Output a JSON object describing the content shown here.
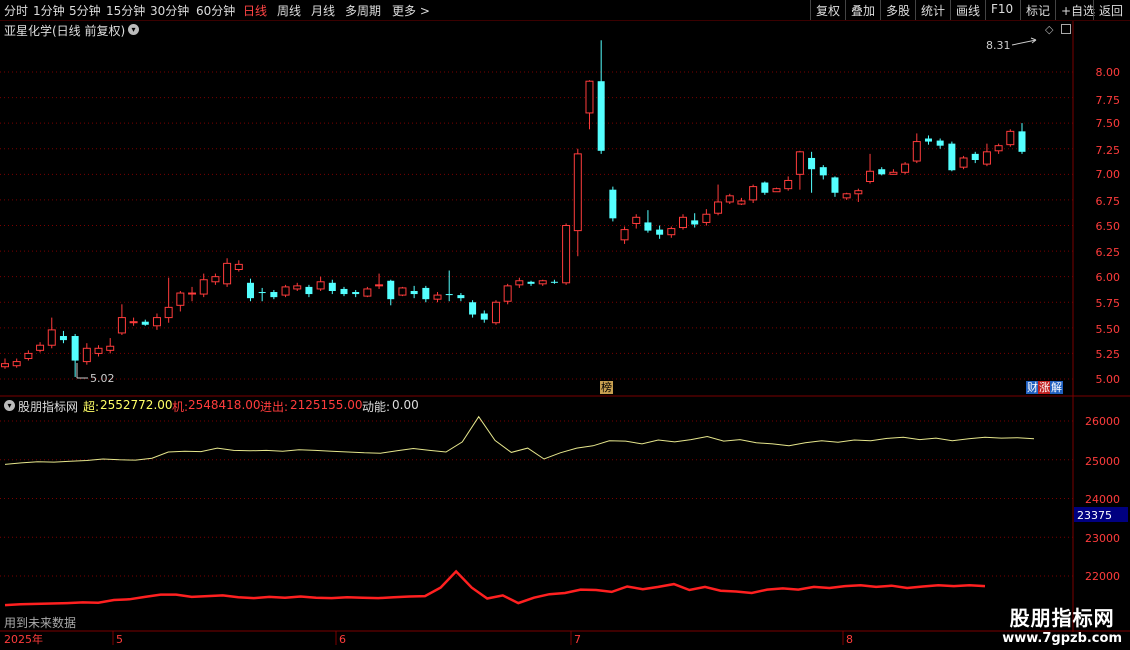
{
  "toolbar": {
    "periods": [
      "分时",
      "1分钟",
      "5分钟",
      "15分钟",
      "30分钟",
      "60分钟",
      "日线",
      "周线",
      "月线",
      "多周期",
      "更多"
    ],
    "active": "日线",
    "right": [
      "复权",
      "叠加",
      "多股",
      "统计",
      "画线",
      "F10",
      "标记",
      "+自选",
      "返回"
    ]
  },
  "stock": {
    "title": "亚星化学(日线 前复权)",
    "high_label": "8.31",
    "low_label": "5.02"
  },
  "price_axis": [
    "8.00",
    "7.75",
    "7.50",
    "7.25",
    "7.00",
    "6.75",
    "6.50",
    "6.25",
    "6.00",
    "5.75",
    "5.50",
    "5.25",
    "5.00"
  ],
  "tags": {
    "bang": "榜",
    "cai": "财",
    "zhang": "涨",
    "jie": "解"
  },
  "indicator": {
    "name": "股朋指标网",
    "chao_label": "超:",
    "chao_value": "2552772.00",
    "ji_label": "机:",
    "ji_value": "2548418.00",
    "jinchu_label": "进出:",
    "jinchu_value": "2125155.00",
    "dongneng_label": "动能:",
    "dongneng_value": "0.00",
    "axis": [
      "26000",
      "25000",
      "24000",
      "23000",
      "22000"
    ],
    "cursor_value": "23375",
    "note": "用到未来数据"
  },
  "dates": [
    "2025年",
    "5",
    "6",
    "7",
    "8"
  ],
  "logo": {
    "main": "股朋指标网",
    "sub": "www.7gpzb.com"
  },
  "colors": {
    "up": "#ff3c3c",
    "down": "#54ffff",
    "grid": "#7a0000",
    "yellow_line": "#e6e68c",
    "red_line": "#ff2020"
  },
  "chart_data": {
    "type": "candlestick",
    "ylim": [
      5.0,
      8.31
    ],
    "candles": [
      [
        5.12,
        5.15,
        5.2,
        5.1
      ],
      [
        5.13,
        5.17,
        5.2,
        5.11
      ],
      [
        5.2,
        5.25,
        5.28,
        5.18
      ],
      [
        5.28,
        5.33,
        5.36,
        5.26
      ],
      [
        5.33,
        5.48,
        5.6,
        5.3
      ],
      [
        5.42,
        5.38,
        5.47,
        5.35
      ],
      [
        5.42,
        5.18,
        5.44,
        5.02
      ],
      [
        5.17,
        5.3,
        5.35,
        5.14
      ],
      [
        5.25,
        5.3,
        5.33,
        5.22
      ],
      [
        5.28,
        5.32,
        5.4,
        5.25
      ],
      [
        5.45,
        5.6,
        5.73,
        5.43
      ],
      [
        5.55,
        5.56,
        5.6,
        5.52
      ],
      [
        5.56,
        5.53,
        5.58,
        5.52
      ],
      [
        5.52,
        5.6,
        5.64,
        5.48
      ],
      [
        5.6,
        5.7,
        5.99,
        5.55
      ],
      [
        5.72,
        5.84,
        5.86,
        5.66
      ],
      [
        5.84,
        5.84,
        5.9,
        5.76
      ],
      [
        5.83,
        5.97,
        6.03,
        5.8
      ],
      [
        5.95,
        6.0,
        6.03,
        5.92
      ],
      [
        5.93,
        6.13,
        6.18,
        5.9
      ],
      [
        6.07,
        6.12,
        6.16,
        6.05
      ],
      [
        5.94,
        5.79,
        5.98,
        5.76
      ],
      [
        5.85,
        5.84,
        5.89,
        5.76
      ],
      [
        5.85,
        5.8,
        5.87,
        5.78
      ],
      [
        5.82,
        5.9,
        5.92,
        5.8
      ],
      [
        5.88,
        5.91,
        5.94,
        5.86
      ],
      [
        5.9,
        5.83,
        5.92,
        5.8
      ],
      [
        5.88,
        5.95,
        6.0,
        5.86
      ],
      [
        5.94,
        5.86,
        5.97,
        5.83
      ],
      [
        5.88,
        5.83,
        5.9,
        5.81
      ],
      [
        5.85,
        5.83,
        5.87,
        5.8
      ],
      [
        5.81,
        5.88,
        5.9,
        5.8
      ],
      [
        5.92,
        5.92,
        6.03,
        5.88
      ],
      [
        5.96,
        5.78,
        5.97,
        5.72
      ],
      [
        5.82,
        5.89,
        5.9,
        5.81
      ],
      [
        5.86,
        5.83,
        5.91,
        5.79
      ],
      [
        5.89,
        5.78,
        5.91,
        5.75
      ],
      [
        5.78,
        5.82,
        5.85,
        5.75
      ],
      [
        5.83,
        5.82,
        6.06,
        5.76
      ],
      [
        5.82,
        5.79,
        5.84,
        5.76
      ],
      [
        5.75,
        5.63,
        5.77,
        5.6
      ],
      [
        5.64,
        5.58,
        5.67,
        5.55
      ],
      [
        5.55,
        5.75,
        5.77,
        5.53
      ],
      [
        5.76,
        5.91,
        5.93,
        5.73
      ],
      [
        5.92,
        5.96,
        5.99,
        5.89
      ],
      [
        5.95,
        5.93,
        5.96,
        5.91
      ],
      [
        5.93,
        5.96,
        5.97,
        5.91
      ],
      [
        5.95,
        5.94,
        5.97,
        5.93
      ],
      [
        5.94,
        6.5,
        6.52,
        5.92
      ],
      [
        6.45,
        7.2,
        7.25,
        6.2
      ],
      [
        7.6,
        7.91,
        7.92,
        7.44
      ],
      [
        7.91,
        7.23,
        8.31,
        7.2
      ],
      [
        6.85,
        6.57,
        6.88,
        6.54
      ],
      [
        6.36,
        6.46,
        6.49,
        6.32
      ],
      [
        6.52,
        6.58,
        6.61,
        6.47
      ],
      [
        6.53,
        6.45,
        6.65,
        6.43
      ],
      [
        6.46,
        6.41,
        6.5,
        6.37
      ],
      [
        6.41,
        6.47,
        6.49,
        6.38
      ],
      [
        6.48,
        6.58,
        6.61,
        6.46
      ],
      [
        6.55,
        6.51,
        6.62,
        6.48
      ],
      [
        6.53,
        6.61,
        6.66,
        6.5
      ],
      [
        6.62,
        6.73,
        6.9,
        6.6
      ],
      [
        6.73,
        6.79,
        6.81,
        6.71
      ],
      [
        6.71,
        6.74,
        6.77,
        6.7
      ],
      [
        6.75,
        6.88,
        6.9,
        6.72
      ],
      [
        6.92,
        6.82,
        6.93,
        6.8
      ],
      [
        6.83,
        6.86,
        6.87,
        6.83
      ],
      [
        6.86,
        6.94,
        6.98,
        6.84
      ],
      [
        7.0,
        7.22,
        7.23,
        6.85
      ],
      [
        7.16,
        7.05,
        7.22,
        6.82
      ],
      [
        7.07,
        6.99,
        7.09,
        6.95
      ],
      [
        6.97,
        6.82,
        6.98,
        6.78
      ],
      [
        6.77,
        6.81,
        6.82,
        6.75
      ],
      [
        6.81,
        6.84,
        6.86,
        6.73
      ],
      [
        6.93,
        7.03,
        7.2,
        6.91
      ],
      [
        7.05,
        7.0,
        7.07,
        6.99
      ],
      [
        7.0,
        7.02,
        7.05,
        7.0
      ],
      [
        7.02,
        7.1,
        7.12,
        7.0
      ],
      [
        7.13,
        7.32,
        7.4,
        7.11
      ],
      [
        7.35,
        7.32,
        7.38,
        7.29
      ],
      [
        7.33,
        7.28,
        7.35,
        7.25
      ],
      [
        7.3,
        7.04,
        7.32,
        7.03
      ],
      [
        7.07,
        7.16,
        7.18,
        7.05
      ],
      [
        7.2,
        7.14,
        7.22,
        7.11
      ],
      [
        7.1,
        7.22,
        7.3,
        7.08
      ],
      [
        7.23,
        7.28,
        7.3,
        7.2
      ],
      [
        7.29,
        7.42,
        7.44,
        7.27
      ],
      [
        7.42,
        7.22,
        7.5,
        7.2
      ]
    ],
    "indicator_yellow": [
      24880,
      24920,
      24950,
      24940,
      24960,
      24980,
      25020,
      25000,
      24990,
      25040,
      25200,
      25220,
      25210,
      25300,
      25240,
      25230,
      25240,
      25220,
      25260,
      25240,
      25220,
      25200,
      25180,
      25170,
      25230,
      25290,
      25240,
      25200,
      25460,
      26110,
      25500,
      25190,
      25300,
      25020,
      25180,
      25300,
      25360,
      25490,
      25480,
      25410,
      25510,
      25460,
      25520,
      25600,
      25480,
      25520,
      25440,
      25410,
      25360,
      25440,
      25490,
      25450,
      25510,
      25490,
      25550,
      25580,
      25520,
      25560,
      25490,
      25540,
      25580,
      25560,
      25570,
      25540
    ],
    "indicator_red": [
      21250,
      21270,
      21280,
      21290,
      21300,
      21320,
      21310,
      21380,
      21400,
      21460,
      21520,
      21520,
      21460,
      21480,
      21500,
      21450,
      21430,
      21460,
      21440,
      21470,
      21440,
      21430,
      21450,
      21440,
      21430,
      21450,
      21470,
      21480,
      21700,
      22120,
      21700,
      21420,
      21500,
      21300,
      21440,
      21530,
      21560,
      21650,
      21640,
      21590,
      21730,
      21660,
      21720,
      21790,
      21640,
      21720,
      21620,
      21600,
      21560,
      21650,
      21680,
      21650,
      21720,
      21690,
      21740,
      21760,
      21720,
      21750,
      21690,
      21730,
      21760,
      21740,
      21760,
      21740
    ]
  }
}
